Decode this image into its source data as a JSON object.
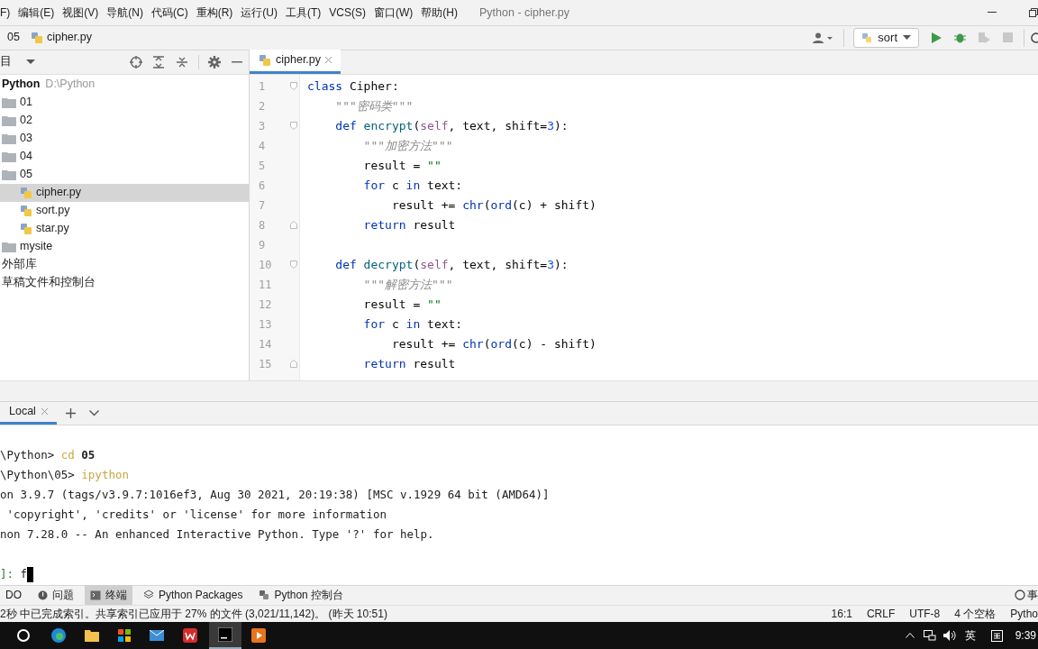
{
  "menu": [
    "F)",
    "编辑(E)",
    "视图(V)",
    "导航(N)",
    "代码(C)",
    "重构(R)",
    "运行(U)",
    "工具(T)",
    "VCS(S)",
    "窗口(W)",
    "帮助(H)"
  ],
  "window": {
    "title": "Python - cipher.py"
  },
  "breadcrumb": [
    "05",
    "cipher.py"
  ],
  "run_config": "sort",
  "project": {
    "header": "目",
    "root": {
      "name": "Python",
      "path": "D:\\Python"
    },
    "tree": [
      {
        "name": "01",
        "kind": "folder",
        "selected": false
      },
      {
        "name": "02",
        "kind": "folder",
        "selected": false
      },
      {
        "name": "03",
        "kind": "folder",
        "selected": false
      },
      {
        "name": "04",
        "kind": "folder",
        "selected": false
      },
      {
        "name": "05",
        "kind": "folder",
        "selected": false,
        "children": [
          {
            "name": "cipher.py",
            "kind": "file",
            "selected": true
          },
          {
            "name": "sort.py",
            "kind": "file",
            "selected": false
          },
          {
            "name": "star.py",
            "kind": "file",
            "selected": false
          }
        ]
      },
      {
        "name": "mysite",
        "kind": "folder",
        "selected": false
      },
      {
        "name": "外部库",
        "kind": "label",
        "selected": false
      },
      {
        "name": "草稿文件和控制台",
        "kind": "label",
        "selected": false
      }
    ]
  },
  "editor_tabs": [
    {
      "label": "cipher.py",
      "selected": true
    }
  ],
  "code": [
    {
      "n": "1",
      "kind": "fold-start",
      "tokens": [
        {
          "kind": "keyword",
          "t": "class"
        },
        {
          "kind": "plain",
          "t": " Cipher:"
        }
      ]
    },
    {
      "n": "2",
      "kind": "plain",
      "tokens": [
        {
          "kind": "docstring",
          "t": "    \"\"\"密码类\"\"\""
        }
      ]
    },
    {
      "n": "3",
      "kind": "fold-start",
      "tokens": [
        {
          "kind": "keyword",
          "t": "    def"
        },
        {
          "kind": "function",
          "t": " encrypt"
        },
        {
          "kind": "plain",
          "t": "("
        },
        {
          "kind": "self",
          "t": "self"
        },
        {
          "kind": "plain",
          "t": ", text, shift="
        },
        {
          "kind": "number",
          "t": "3"
        },
        {
          "kind": "plain",
          "t": "):"
        }
      ]
    },
    {
      "n": "4",
      "kind": "plain",
      "tokens": [
        {
          "kind": "docstring",
          "t": "        \"\"\"加密方法\"\"\""
        }
      ]
    },
    {
      "n": "5",
      "kind": "plain",
      "tokens": [
        {
          "kind": "plain",
          "t": "        result = "
        },
        {
          "kind": "string",
          "t": "\"\""
        }
      ]
    },
    {
      "n": "6",
      "kind": "plain",
      "tokens": [
        {
          "kind": "keyword",
          "t": "        for"
        },
        {
          "kind": "plain",
          "t": " c "
        },
        {
          "kind": "keyword",
          "t": "in"
        },
        {
          "kind": "plain",
          "t": " text:"
        }
      ]
    },
    {
      "n": "7",
      "kind": "plain",
      "tokens": [
        {
          "kind": "plain",
          "t": "            result += "
        },
        {
          "kind": "keyword",
          "t": "chr"
        },
        {
          "kind": "plain",
          "t": "("
        },
        {
          "kind": "keyword",
          "t": "ord"
        },
        {
          "kind": "plain",
          "t": "(c) + shift)"
        }
      ]
    },
    {
      "n": "8",
      "kind": "fold-end",
      "tokens": [
        {
          "kind": "keyword",
          "t": "        return"
        },
        {
          "kind": "plain",
          "t": " result"
        }
      ]
    },
    {
      "n": "9",
      "kind": "plain"
    },
    {
      "n": "10",
      "kind": "fold-start",
      "tokens": [
        {
          "kind": "keyword",
          "t": "    def"
        },
        {
          "kind": "function",
          "t": " decrypt"
        },
        {
          "kind": "plain",
          "t": "("
        },
        {
          "kind": "self",
          "t": "self"
        },
        {
          "kind": "plain",
          "t": ", text, shift="
        },
        {
          "kind": "number",
          "t": "3"
        },
        {
          "kind": "plain",
          "t": "):"
        }
      ]
    },
    {
      "n": "11",
      "kind": "plain",
      "tokens": [
        {
          "kind": "docstring",
          "t": "        \"\"\"解密方法\"\"\""
        }
      ]
    },
    {
      "n": "12",
      "kind": "plain",
      "tokens": [
        {
          "kind": "plain",
          "t": "        result = "
        },
        {
          "kind": "string",
          "t": "\"\""
        }
      ]
    },
    {
      "n": "13",
      "kind": "plain",
      "tokens": [
        {
          "kind": "keyword",
          "t": "        for"
        },
        {
          "kind": "plain",
          "t": " c "
        },
        {
          "kind": "keyword",
          "t": "in"
        },
        {
          "kind": "plain",
          "t": " text:"
        }
      ]
    },
    {
      "n": "14",
      "kind": "plain",
      "tokens": [
        {
          "kind": "plain",
          "t": "            result += "
        },
        {
          "kind": "keyword",
          "t": "chr"
        },
        {
          "kind": "plain",
          "t": "("
        },
        {
          "kind": "keyword",
          "t": "ord"
        },
        {
          "kind": "plain",
          "t": "(c) - shift)"
        }
      ]
    },
    {
      "n": "15",
      "kind": "fold-end",
      "tokens": [
        {
          "kind": "keyword",
          "t": "        return"
        },
        {
          "kind": "plain",
          "t": " result"
        }
      ]
    }
  ],
  "terminal_tabs": [
    {
      "label": "Local",
      "selected": true
    }
  ],
  "terminal": [
    {
      "kind": "line",
      "segments": [
        {
          "kind": "plain",
          "t": "\\Python> "
        },
        {
          "kind": "command",
          "t": "cd"
        },
        {
          "kind": "bold",
          "t": " 05"
        }
      ]
    },
    {
      "kind": "line",
      "segments": [
        {
          "kind": "plain",
          "t": "\\Python\\05> "
        },
        {
          "kind": "command",
          "t": "ipython"
        }
      ]
    },
    {
      "kind": "line",
      "segments": [
        {
          "kind": "plain",
          "t": "on 3.9.7 (tags/v3.9.7:1016ef3, Aug 30 2021, 20:19:38) [MSC v.1929 64 bit (AMD64)]"
        }
      ]
    },
    {
      "kind": "line",
      "segments": [
        {
          "kind": "plain",
          "t": " 'copyright', 'credits' or 'license' for more information"
        }
      ]
    },
    {
      "kind": "line",
      "segments": [
        {
          "kind": "plain",
          "t": "non 7.28.0 -- An enhanced Interactive Python. Type '?' for help."
        }
      ]
    },
    {
      "kind": "blank"
    },
    {
      "kind": "line",
      "segments": [
        {
          "kind": "prompt",
          "t": "]: "
        },
        {
          "kind": "plain",
          "t": "f"
        }
      ],
      "cursor": true
    }
  ],
  "tool_tabs": [
    {
      "label": "DO",
      "kind": "plain",
      "selected": false
    },
    {
      "label": "问题",
      "kind": "info",
      "selected": false
    },
    {
      "label": "终端",
      "kind": "terminal",
      "selected": true
    },
    {
      "label": "Python Packages",
      "kind": "layers",
      "selected": false
    },
    {
      "label": "Python 控制台",
      "kind": "python",
      "selected": false
    }
  ],
  "tool_right": "事",
  "status_bar": {
    "message": "2秒 中已完成索引。共享索引已应用于 27% 的文件 (3,021/11,142)。 (昨天 10:51)",
    "items": [
      "16:1",
      "CRLF",
      "UTF-8",
      "4 个空格",
      "Pytho"
    ]
  },
  "taskbar": {
    "ime": "英",
    "time": "9:39"
  }
}
